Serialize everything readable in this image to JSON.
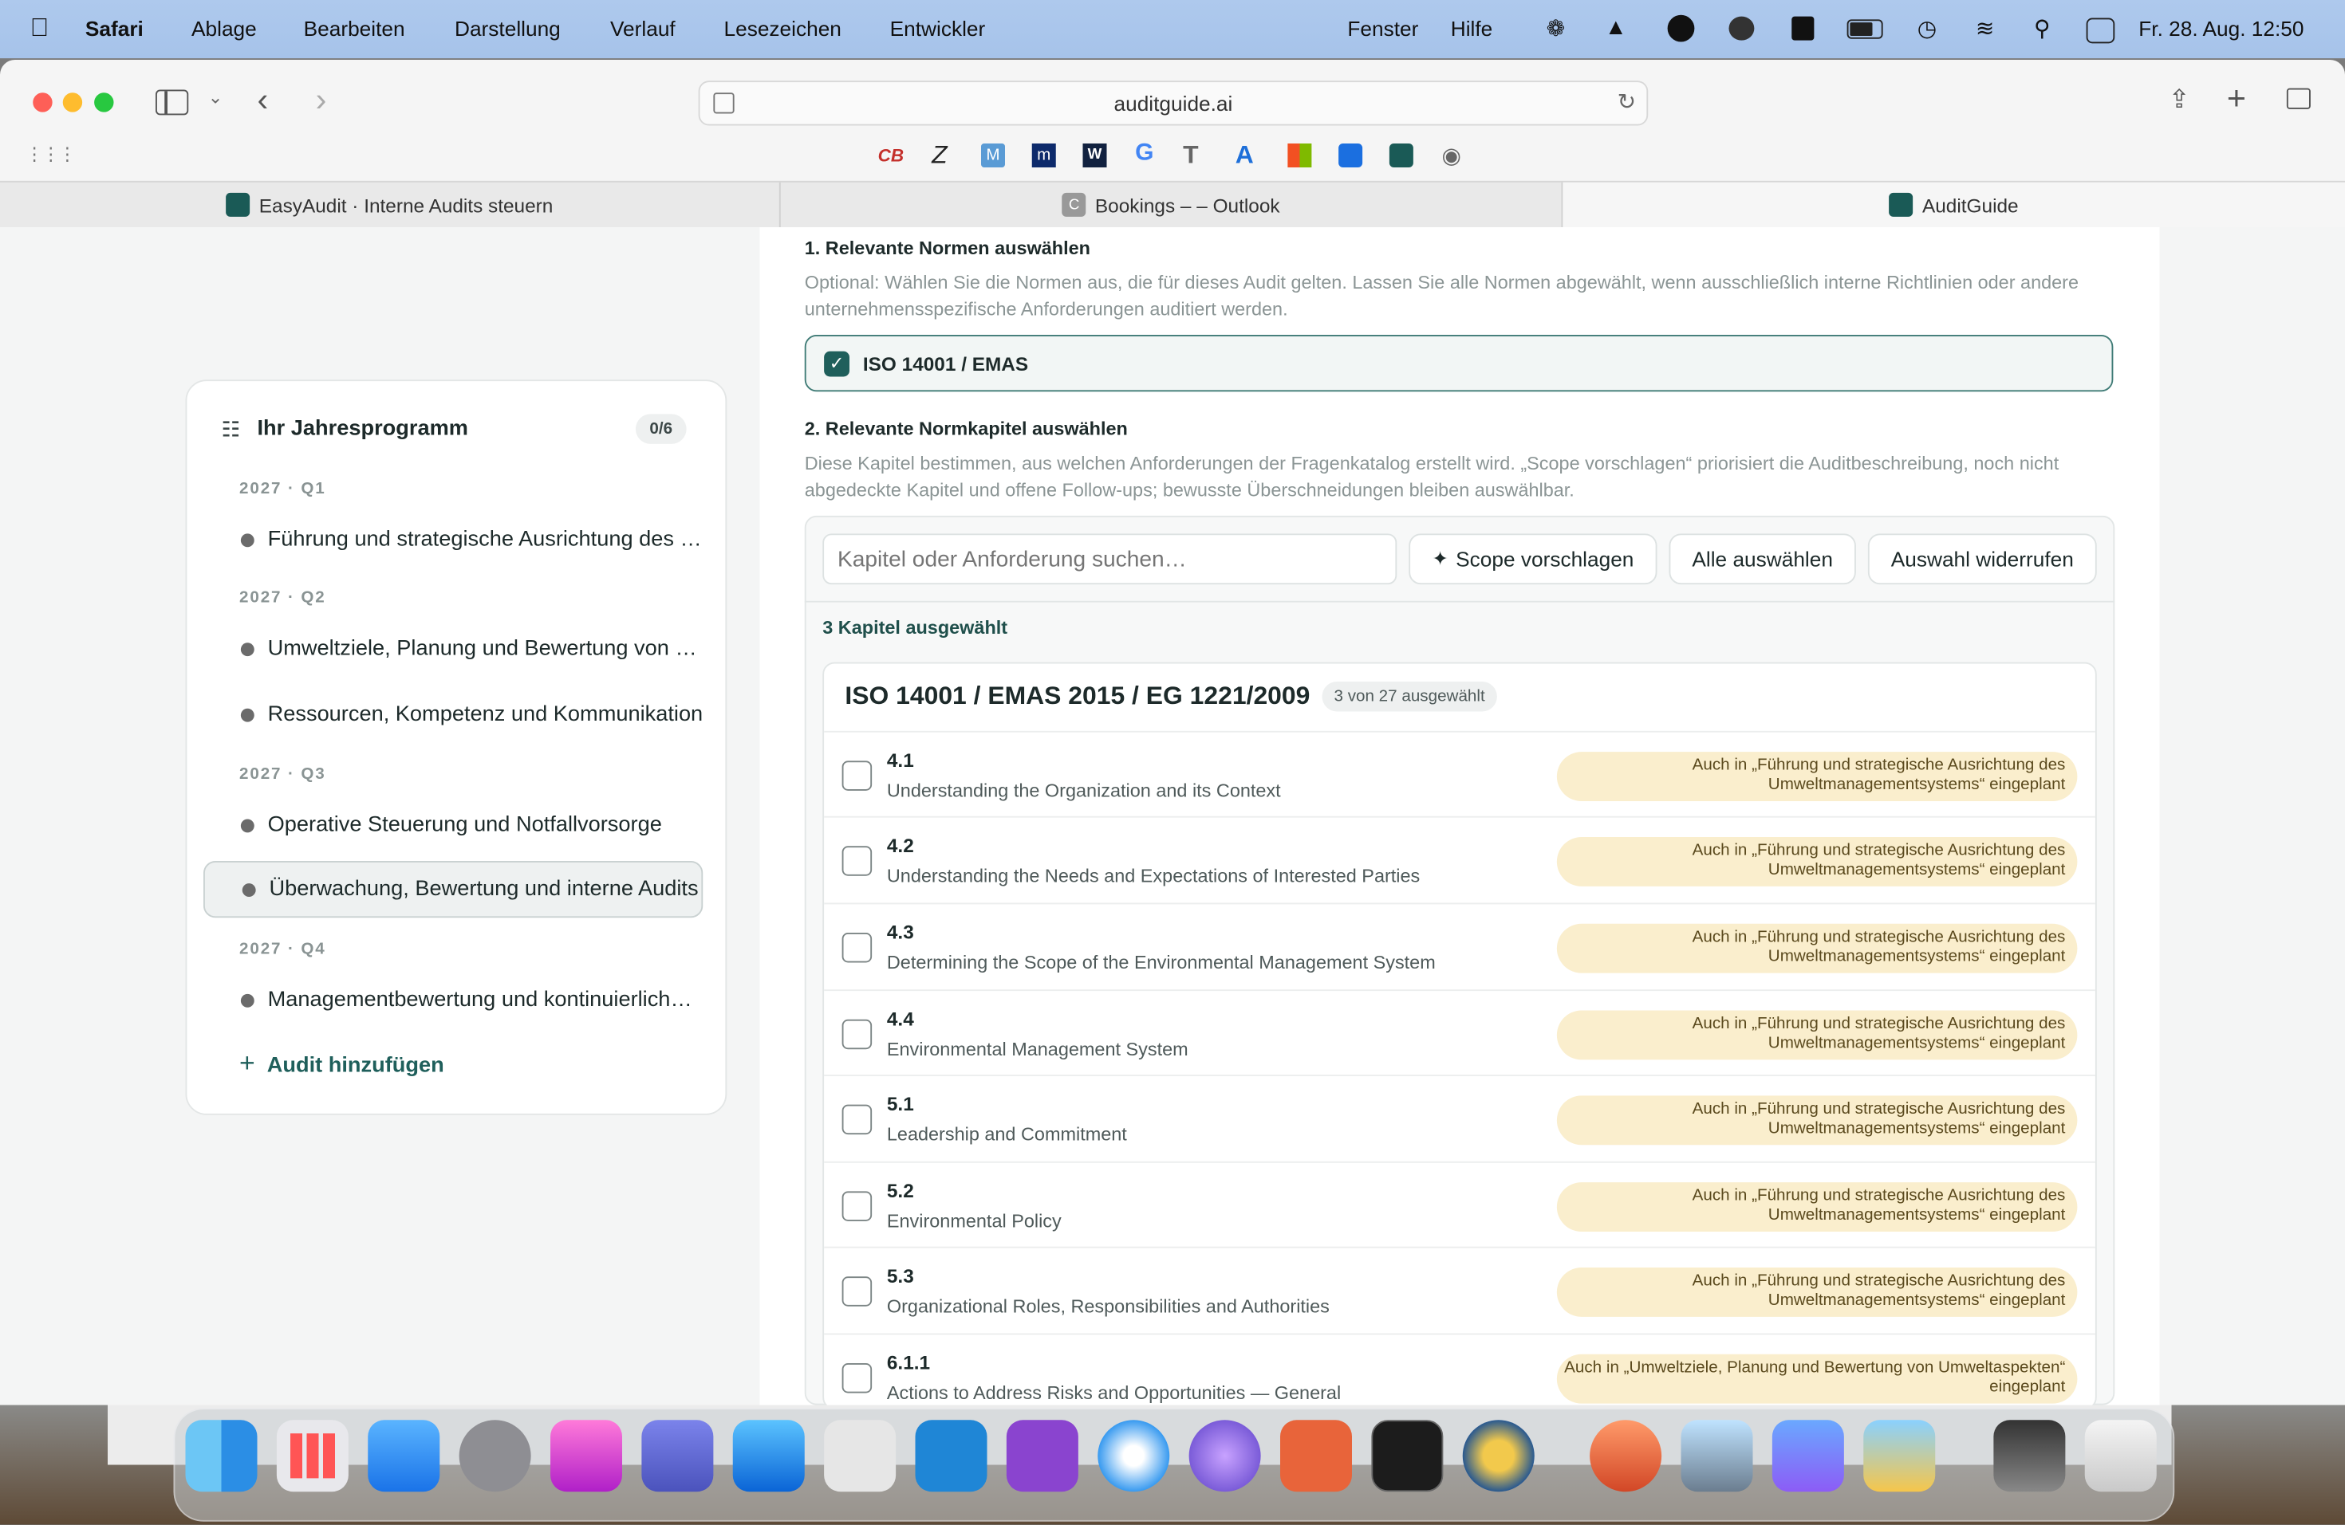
{
  "menubar": {
    "apple_icon": "apple-icon",
    "app": "Safari",
    "items": [
      "Ablage",
      "Bearbeiten",
      "Darstellung",
      "Verlauf",
      "Lesezeichen",
      "Entwickler"
    ],
    "right_items": [
      "Fenster",
      "Hilfe"
    ],
    "clock": "Fr. 28. Aug.  12:50"
  },
  "browser": {
    "url": "auditguide.ai",
    "tabs": [
      {
        "label": "EasyAudit · Interne Audits steuern"
      },
      {
        "label": "Bookings – – Outlook"
      },
      {
        "label": "AuditGuide"
      }
    ],
    "bookmarks": [
      "CB",
      "Z",
      "M",
      "m",
      "W",
      "G",
      "T",
      "A",
      "MS",
      "J",
      "AG",
      "globe"
    ]
  },
  "program": {
    "title": "Ihr Jahresprogramm",
    "badge": "0/6",
    "quarters": [
      {
        "label": "2027 · Q1",
        "items": [
          "Führung und strategische Ausrichtung des Umweltmanagementsystems"
        ]
      },
      {
        "label": "2027 · Q2",
        "items": [
          "Umweltziele, Planung und Bewertung von Umweltaspekten",
          "Ressourcen, Kompetenz und Kommunikation"
        ]
      },
      {
        "label": "2027 · Q3",
        "items": [
          "Operative Steuerung und Notfallvorsorge",
          "Überwachung, Bewertung und interne Audits"
        ]
      },
      {
        "label": "2027 · Q4",
        "items": [
          "Managementbewertung und kontinuierliche Verbesserung"
        ]
      }
    ],
    "add_label": "Audit hinzufügen"
  },
  "main": {
    "section1_title": "1. Relevante Normen auswählen",
    "section1_desc": "Optional: Wählen Sie die Normen aus, die für dieses Audit gelten. Lassen Sie alle Normen abgewählt, wenn ausschließlich interne Richtlinien oder andere unternehmensspezifische Anforderungen auditiert werden.",
    "norm_label": "ISO 14001 / EMAS",
    "section2_title": "2. Relevante Normkapitel auswählen",
    "section2_desc": "Diese Kapitel bestimmen, aus welchen Anforderungen der Fragenkatalog erstellt wird. „Scope vorschlagen“ priorisiert die Auditbeschreibung, noch nicht abgedeckte Kapitel und offene Follow-ups; bewusste Überschneidungen bleiben auswählbar.",
    "search_placeholder": "Kapitel oder Anforderung suchen…",
    "btn_scope": "Scope vorschlagen",
    "btn_all": "Alle auswählen",
    "btn_undo": "Auswahl widerrufen",
    "selected_count": "3 Kapitel ausgewählt",
    "standard_title": "ISO 14001 / EMAS 2015 / EG 1221/2009",
    "standard_badge": "3 von 27 ausgewählt",
    "chapters": [
      {
        "num": "4.1",
        "title": "Understanding the Organization and its Context",
        "note": "Auch in „Führung und strategische Ausrichtung des Umweltmanagementsystems“ eingeplant"
      },
      {
        "num": "4.2",
        "title": "Understanding the Needs and Expectations of Interested Parties",
        "note": "Auch in „Führung und strategische Ausrichtung des Umweltmanagementsystems“ eingeplant"
      },
      {
        "num": "4.3",
        "title": "Determining the Scope of the Environmental Management System",
        "note": "Auch in „Führung und strategische Ausrichtung des Umweltmanagementsystems“ eingeplant"
      },
      {
        "num": "4.4",
        "title": "Environmental Management System",
        "note": "Auch in „Führung und strategische Ausrichtung des Umweltmanagementsystems“ eingeplant"
      },
      {
        "num": "5.1",
        "title": "Leadership and Commitment",
        "note": "Auch in „Führung und strategische Ausrichtung des Umweltmanagementsystems“ eingeplant"
      },
      {
        "num": "5.2",
        "title": "Environmental Policy",
        "note": "Auch in „Führung und strategische Ausrichtung des Umweltmanagementsystems“ eingeplant"
      },
      {
        "num": "5.3",
        "title": "Organizational Roles, Responsibilities and Authorities",
        "note": "Auch in „Führung und strategische Ausrichtung des Umweltmanagementsystems“ eingeplant"
      },
      {
        "num": "6.1.1",
        "title": "Actions to Address Risks and Opportunities — General",
        "note": "Auch in „Umweltziele, Planung und Bewertung von Umweltaspekten“ eingeplant"
      }
    ]
  },
  "dock": [
    "Finder",
    "Launchpad",
    "Mail",
    "Systemeinstellungen",
    "Keynote",
    "Teams",
    "Outlook",
    "Bildschirmfoto",
    "Visual Studio Code",
    "GitHub Desktop",
    "Safari",
    "Siri",
    "Claude",
    "Terminal",
    "Cyberduck",
    "PowerPoint",
    "Vorschau",
    "Copilot",
    "Schlüsselbund",
    "Downloads",
    "Papierkorb"
  ],
  "colors": {
    "accent": "#1f5f5b",
    "note_bg": "#faeecd",
    "menubar": "#a8c4ea"
  }
}
